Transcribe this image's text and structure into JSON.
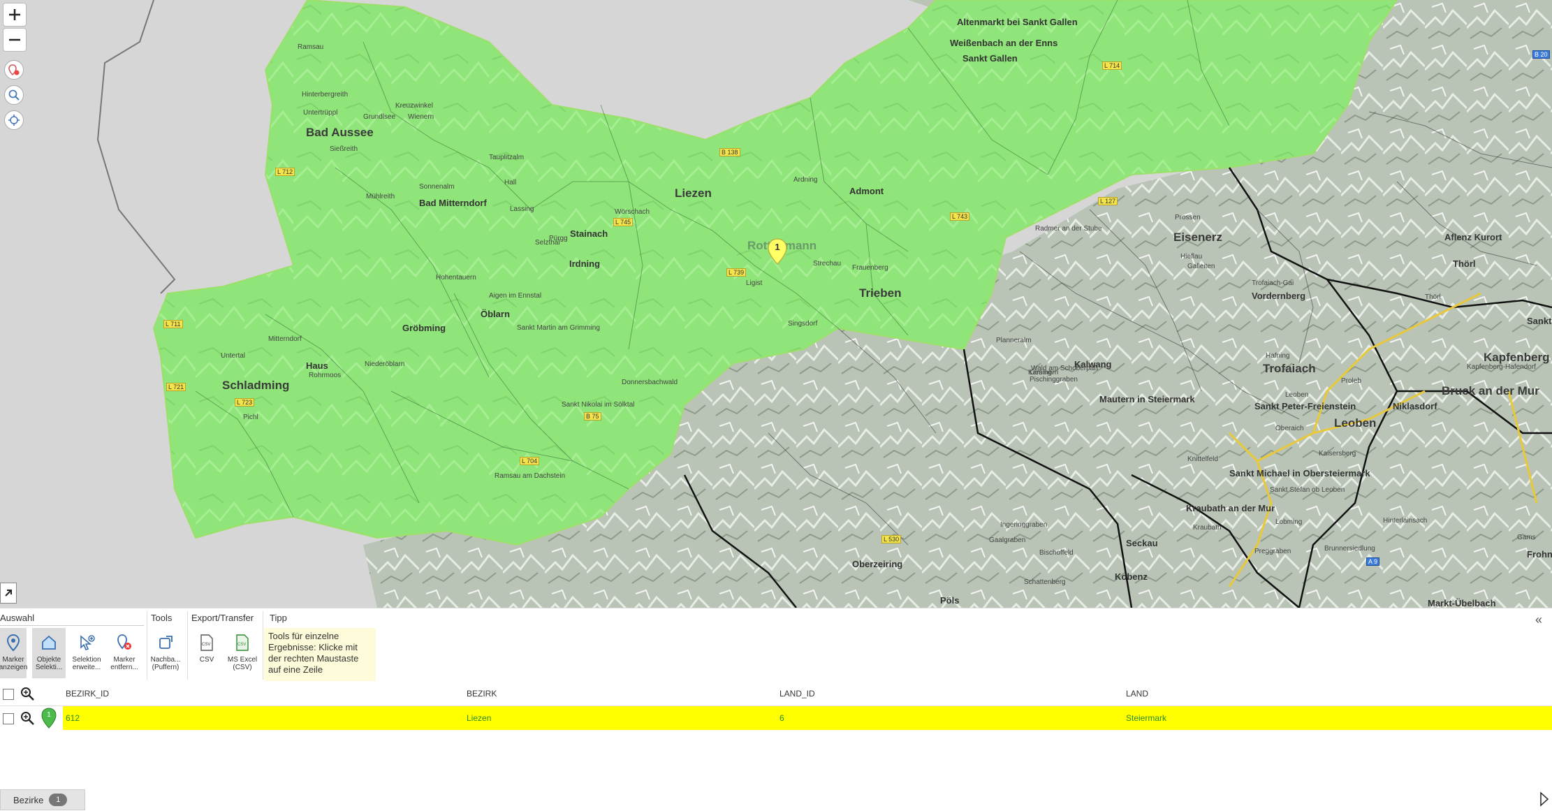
{
  "map": {
    "towns_big": [
      "Bad Aussee",
      "Liezen",
      "Schladming",
      "Eisenerz",
      "Trofaiach",
      "Leoben",
      "Bruck an der Mur",
      "Kapfenberg",
      "Trieben",
      "Rottenmann"
    ],
    "towns_mid": [
      "Bad Mitterndorf",
      "Stainach",
      "Irdning",
      "Gröbming",
      "Öblarn",
      "Haus",
      "Admont",
      "Sankt Gallen",
      "Altenmarkt bei Sankt Gallen",
      "Weißenbach an der Enns",
      "Vordernberg",
      "Kalwang",
      "Mautern in Steiermark",
      "Sankt Peter-Freienstein",
      "Niklasdorf",
      "Sankt Michael in Obersteiermark",
      "Kraubath an der Mur",
      "Seckau",
      "Kobenz",
      "Oberzeiring",
      "Pöls",
      "Aflenz Kurort",
      "Thörl",
      "Frohnleiten",
      "Markt-Übelbach",
      "Sankt Ma"
    ],
    "towns_small": [
      "Ramsau",
      "Kreuzwinkel",
      "Grundlsee",
      "Wienern",
      "Hinterbergreith",
      "Untertrüppl",
      "Sießreith",
      "Tauplitzalm",
      "Sonnenalm",
      "Mühlreith",
      "Wörschach",
      "Hall",
      "Pürgg",
      "Lassing",
      "Selzthal",
      "Ardning",
      "Frauenberg",
      "Ligist",
      "Strechau",
      "Singsdorf",
      "Hohentauern",
      "Sankt Martin am Grimming",
      "Aigen im Ennstal",
      "Niederöblarn",
      "Mitterndorf",
      "Rohrmoos",
      "Pichl",
      "Untertal",
      "Ramsau am Dachstein",
      "Sankt Nikolai im Sölktal",
      "Donnersbachwald",
      "Planneralm",
      "Wald am Schoberpaß",
      "Kammern",
      "Liesing",
      "Pischinggraben",
      "Prossen",
      "Radmer an der Stube",
      "Hieflau",
      "Galleiten",
      "Trofaiach-Gai",
      "Leoben",
      "Hafning",
      "Proleb",
      "Kaisersberg",
      "Oberaich",
      "Sankt Stefan ob Leoben",
      "Knittelfeld",
      "Bischoffeld",
      "Ingeringgraben",
      "Gaalgraben",
      "Schattenberg",
      "Lobming",
      "Preggraben",
      "Gams",
      "Hinterlainsach",
      "Kraubath",
      "Brunnersiedlung",
      "Kapfenberg-Hafendorf",
      "Thörl"
    ],
    "roads": [
      "L 712",
      "B 138",
      "L 745",
      "L 739",
      "L 743",
      "L 714",
      "L 127",
      "L 711",
      "L 721",
      "L 723",
      "B 75",
      "L 704",
      "L 530",
      "A 9",
      "B 20"
    ],
    "marker_label": "1"
  },
  "ribbon": {
    "groups": [
      "Auswahl",
      "Tools",
      "Export/Transfer",
      "Tipp"
    ],
    "buttons": [
      {
        "label": "Marker anzeigen"
      },
      {
        "label": "Objekte Selekti..."
      },
      {
        "label": "Selektion erweite..."
      },
      {
        "label": "Marker entfern..."
      },
      {
        "label": "Nachba... (Puffern)"
      },
      {
        "label": "CSV"
      },
      {
        "label": "MS Excel (CSV)"
      }
    ],
    "tip": "Tools für einzelne Ergebnisse: Klicke mit der rechten Maustaste auf eine Zeile",
    "collapse": "«"
  },
  "grid": {
    "columns": [
      "BEZIRK_ID",
      "BEZIRK",
      "LAND_ID",
      "LAND"
    ],
    "rows": [
      {
        "marker": "1",
        "bezirk_id": "612",
        "bezirk": "Liezen",
        "land_id": "6",
        "land": "Steiermark"
      }
    ]
  },
  "tabs": [
    {
      "label": "Bezirke",
      "count": "1"
    }
  ],
  "colors": {
    "highlight": "#ffff00",
    "district_fill": "#90ee70",
    "marker": "#ffff66"
  }
}
